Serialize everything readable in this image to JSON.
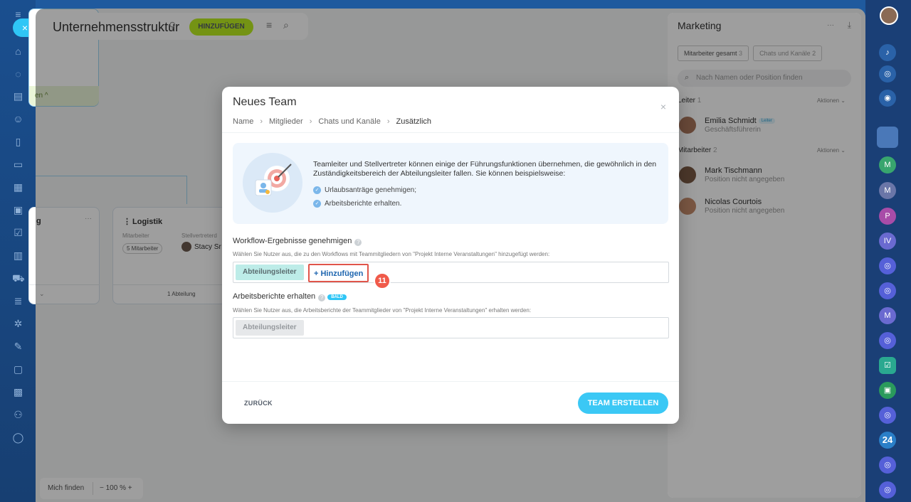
{
  "header": {
    "title": "Unternehmensstruktur",
    "add_label": "HINZUFÜGEN"
  },
  "org": {
    "card_left_footer": "en ^",
    "logistik_title": "Logistik",
    "col_mitarbeiter": "Mitarbeiter",
    "col_stellvertreter": "Stellvertreterd",
    "mitarbeiter_count": "5 Mitarbeiter",
    "stellvertreter_name": "Stacy Sr",
    "card_g_title": "g",
    "abteilung_count": "1 Abteilung",
    "more": "···"
  },
  "bottom": {
    "find_me": "Mich finden",
    "zoom": "− 100 % +"
  },
  "right_panel": {
    "title": "Marketing",
    "tabs": [
      {
        "label": "Mitarbeiter gesamt",
        "count": "3"
      },
      {
        "label": "Chats und Kanäle",
        "count": "2"
      }
    ],
    "search_placeholder": "Nach Namen oder Position finden",
    "leader_section": "Leiter",
    "leader_count": "1",
    "actions": "Aktionen",
    "staff_section": "Mitarbeiter",
    "staff_count": "2",
    "people": [
      {
        "name": "Emilia Schmidt",
        "badge": "Leiter",
        "position": "Geschäftsführerin"
      },
      {
        "name": "Mark Tischmann",
        "position": "Position nicht angegeben"
      },
      {
        "name": "Nicolas Courtois",
        "position": "Position nicht angegeben"
      }
    ]
  },
  "modal": {
    "title": "Neues Team",
    "breadcrumbs": [
      "Name",
      "Mitglieder",
      "Chats und Kanäle",
      "Zusätzlich"
    ],
    "info_text": "Teamleiter und Stellvertreter können einige der Führungsfunktionen übernehmen, die gewöhnlich in den Zuständigkeitsbereich der Abteilungsleiter fallen. Sie können beispielsweise:",
    "info_items": [
      "Urlaubsanträge genehmigen;",
      "Arbeitsberichte erhalten."
    ],
    "workflow_title": "Workflow-Ergebnisse genehmigen",
    "workflow_desc": "Wählen Sie Nutzer aus, die zu den Workflows mit Teammitgliedern von \"Projekt Interne Veranstaltungen\" hinzugefügt werden:",
    "workflow_chip": "Abteilungsleiter",
    "workflow_add": "+ Hinzufügen",
    "step_badge": "11",
    "reports_title": "Arbeitsberichte erhalten",
    "reports_soon": "BALD",
    "reports_desc": "Wählen Sie Nutzer aus, die Arbeitsberichte der Teammitglieder von \"Projekt Interne Veranstaltungen\" erhalten werden:",
    "reports_chip": "Abteilungsleiter",
    "back_label": "ZURÜCK",
    "create_label": "TEAM ERSTELLEN"
  },
  "rightbar": {
    "counter": "24"
  },
  "colors": {
    "accent": "#3bc8f5",
    "add_green": "#bbed21",
    "highlight": "#e0554a"
  }
}
